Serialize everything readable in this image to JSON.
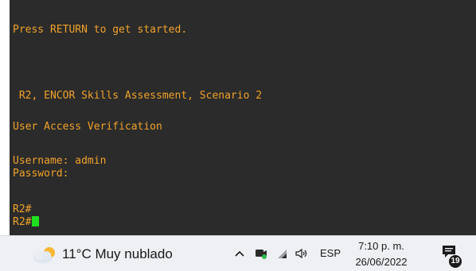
{
  "terminal": {
    "lines": [
      "Press RETURN to get started.",
      " R2, ENCOR Skills Assessment, Scenario 2",
      "User Access Verification",
      "Username: admin",
      "Password:",
      "R2#",
      "R2#"
    ],
    "text_color": "#f0a22b",
    "cursor_color": "#1fe01f",
    "background": "#2b2b2b"
  },
  "taskbar": {
    "weather": {
      "icon": "cloud-sun-icon",
      "text": "11°C  Muy nublado"
    },
    "tray": {
      "chevron_icon": "chevron-up-icon",
      "icons": [
        "meet-now-icon",
        "wifi-icon",
        "volume-icon"
      ],
      "language": "ESP"
    },
    "clock": {
      "time": "7:10 p. m.",
      "date": "26/06/2022"
    },
    "notifications": {
      "icon": "notification-icon",
      "count": "19"
    }
  }
}
